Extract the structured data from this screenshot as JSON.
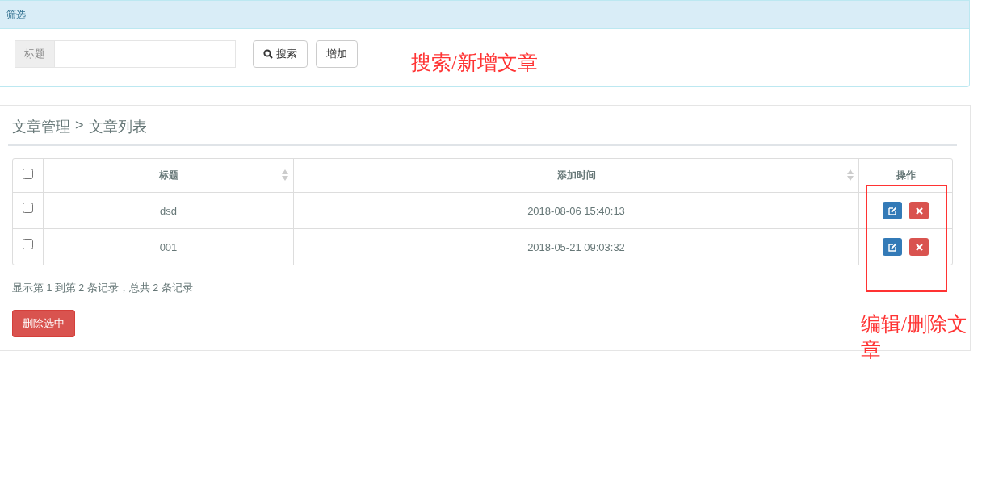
{
  "filter_panel": {
    "title": "筛选",
    "search_field": {
      "label": "标题"
    },
    "buttons": [
      {
        "kind": "search",
        "label": "搜索"
      },
      {
        "kind": "plain",
        "label": "增加"
      }
    ]
  },
  "annotations": [
    {
      "kind": "text",
      "text": "搜索/新增文章"
    },
    {
      "kind": "box"
    },
    {
      "kind": "text",
      "text": "编辑/删除文章"
    }
  ],
  "list_panel": {
    "breadcrumb": {
      "parent": "文章管理",
      "separator": ">",
      "current": "文章列表"
    },
    "table": {
      "select_all": {
        "checked": false
      },
      "columns": [
        {
          "label": "标题",
          "sortable": true
        },
        {
          "label": "添加时间",
          "sortable": true
        },
        {
          "label": "操作",
          "sortable": false
        }
      ],
      "rows": [
        {
          "checked": false,
          "title": "dsd",
          "added": "2018-08-06 15:40:13"
        },
        {
          "checked": false,
          "title": "001",
          "added": "2018-05-21 09:03:32"
        }
      ]
    },
    "summary": "显示第 1 到第 2 条记录，总共 2 条记录",
    "delete_button": "删除选中"
  }
}
